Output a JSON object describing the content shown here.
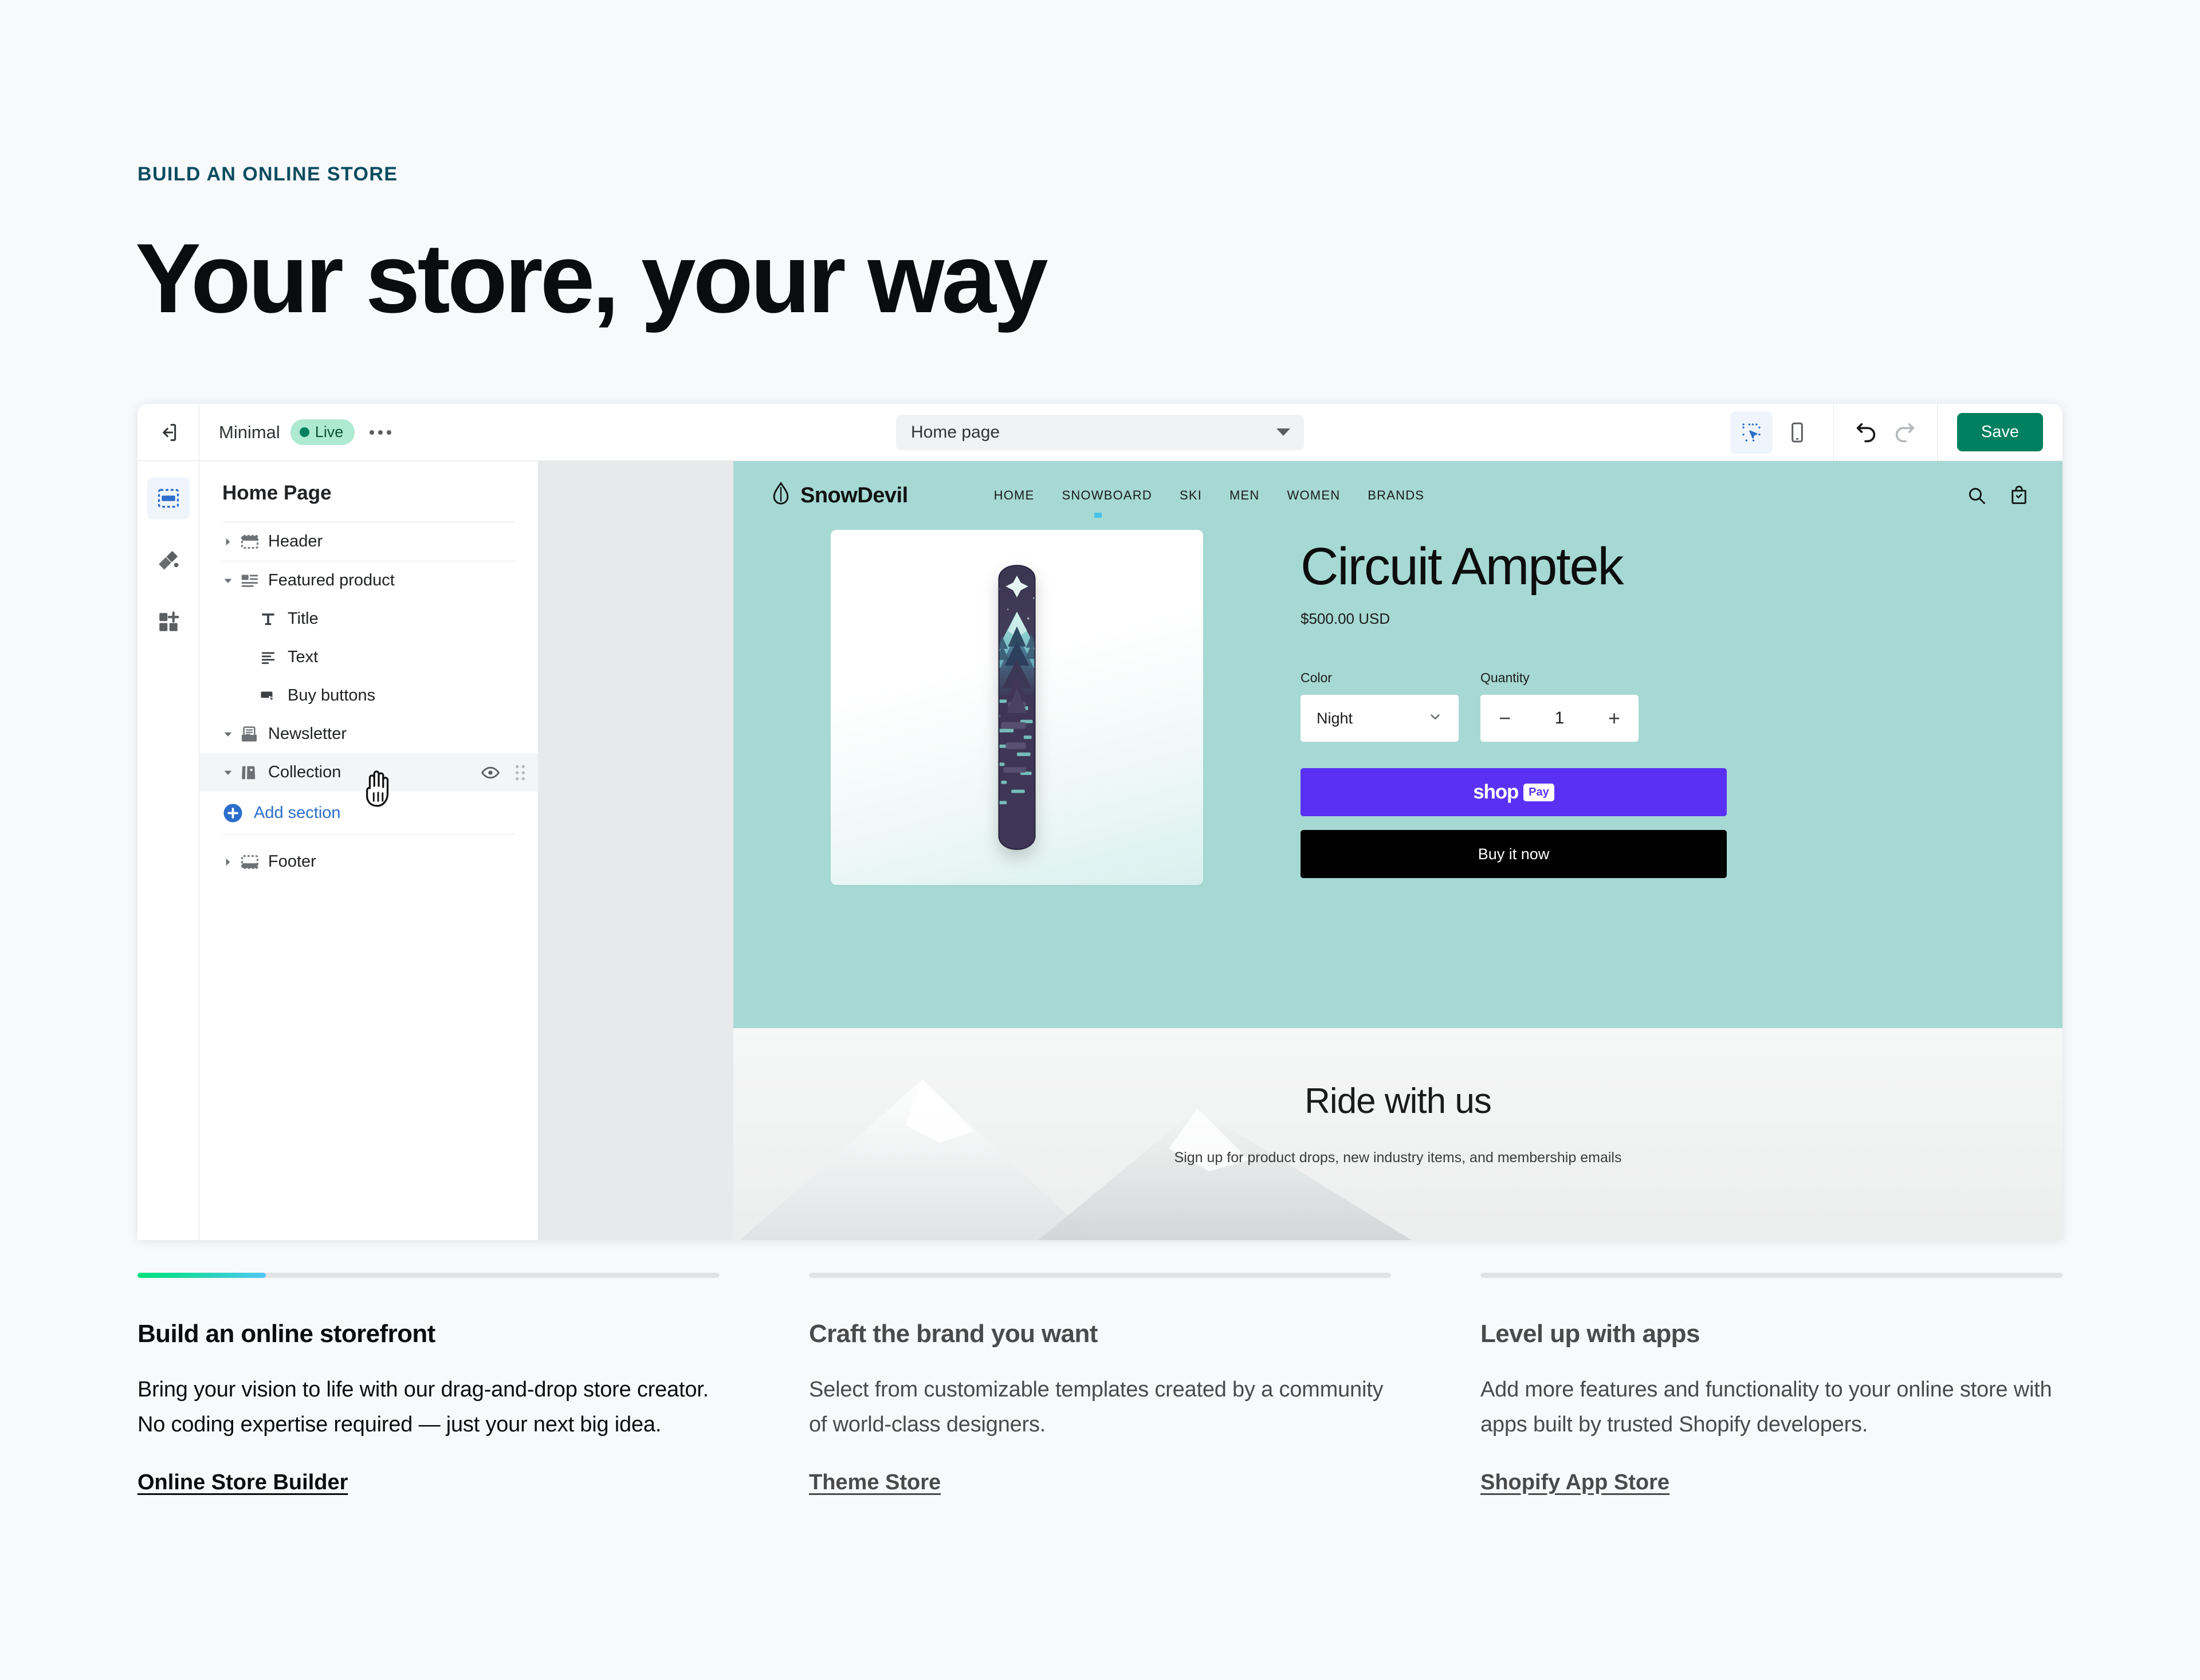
{
  "hero": {
    "eyebrow": "BUILD AN ONLINE STORE",
    "title": "Your store, your way"
  },
  "editor": {
    "topbar": {
      "back_icon": "exit-icon",
      "theme_name": "Minimal",
      "status_badge": "Live",
      "more_icon": "ellipsis-icon",
      "page_selector_value": "Home page",
      "desktop_view_icon": "select-pointer-icon",
      "mobile_view_icon": "mobile-icon",
      "undo_icon": "undo-icon",
      "redo_icon": "redo-icon",
      "save_label": "Save",
      "save_color": "#008060"
    },
    "rail": [
      {
        "name": "sections-icon",
        "label": "Sections",
        "active": true
      },
      {
        "name": "paintbrush-icon",
        "label": "Theme settings",
        "active": false
      },
      {
        "name": "apps-icon",
        "label": "Apps",
        "active": false
      }
    ],
    "tree": {
      "title": "Home Page",
      "add_section_label": "Add section",
      "nodes": [
        {
          "label": "Header",
          "icon": "header-block-icon",
          "expanded": false,
          "depth": 0,
          "selected": false
        },
        {
          "label": "Featured product",
          "icon": "featured-product-icon",
          "expanded": true,
          "depth": 0,
          "selected": false
        },
        {
          "label": "Title",
          "icon": "text-title-icon",
          "expanded": null,
          "depth": 1,
          "selected": false
        },
        {
          "label": "Text",
          "icon": "text-lines-icon",
          "expanded": null,
          "depth": 1,
          "selected": false
        },
        {
          "label": "Buy buttons",
          "icon": "buy-button-icon",
          "expanded": null,
          "depth": 1,
          "selected": false
        },
        {
          "label": "Newsletter",
          "icon": "newsletter-icon",
          "expanded": true,
          "depth": 0,
          "selected": false
        },
        {
          "label": "Collection",
          "icon": "collection-tag-icon",
          "expanded": true,
          "depth": 0,
          "selected": true
        },
        {
          "label": "Footer",
          "icon": "footer-block-icon",
          "expanded": false,
          "depth": 0,
          "selected": false
        }
      ]
    },
    "preview": {
      "background_color": "#a6d9d4",
      "store": {
        "brand": "SnowDevil",
        "nav": [
          "HOME",
          "SNOWBOARD",
          "SKI",
          "MEN",
          "WOMEN",
          "BRANDS"
        ],
        "active_nav": "SNOWBOARD",
        "search_icon": "search-icon",
        "cart_icon": "cart-icon"
      },
      "product": {
        "title": "Circuit Amptek",
        "price": "$500.00 USD",
        "color_label": "Color",
        "color_value": "Night",
        "quantity_label": "Quantity",
        "quantity_value": "1",
        "decrement_label": "−",
        "increment_label": "+",
        "shop_pay_word": "shop",
        "shop_pay_chip": "Pay",
        "shop_pay_color": "#5a31f4",
        "buy_now_label": "Buy it now"
      },
      "newsletter": {
        "heading": "Ride with us",
        "body": "Sign up for product drops, new industry items, and membership emails"
      }
    }
  },
  "columns": [
    {
      "heading": "Build an online storefront",
      "body": "Bring your vision to life with our drag-and-drop store creator. No coding expertise required — just your next big idea.",
      "link": "Online Store Builder",
      "progress": 22,
      "active": true
    },
    {
      "heading": "Craft the brand you want",
      "body": "Select from customizable templates created by a community of world-class designers.",
      "link": "Theme Store",
      "progress": 0,
      "active": false
    },
    {
      "heading": "Level up with apps",
      "body": "Add more features and functionality to your online store with apps built by trusted Shopify developers.",
      "link": "Shopify App Store",
      "progress": 0,
      "active": false
    }
  ]
}
